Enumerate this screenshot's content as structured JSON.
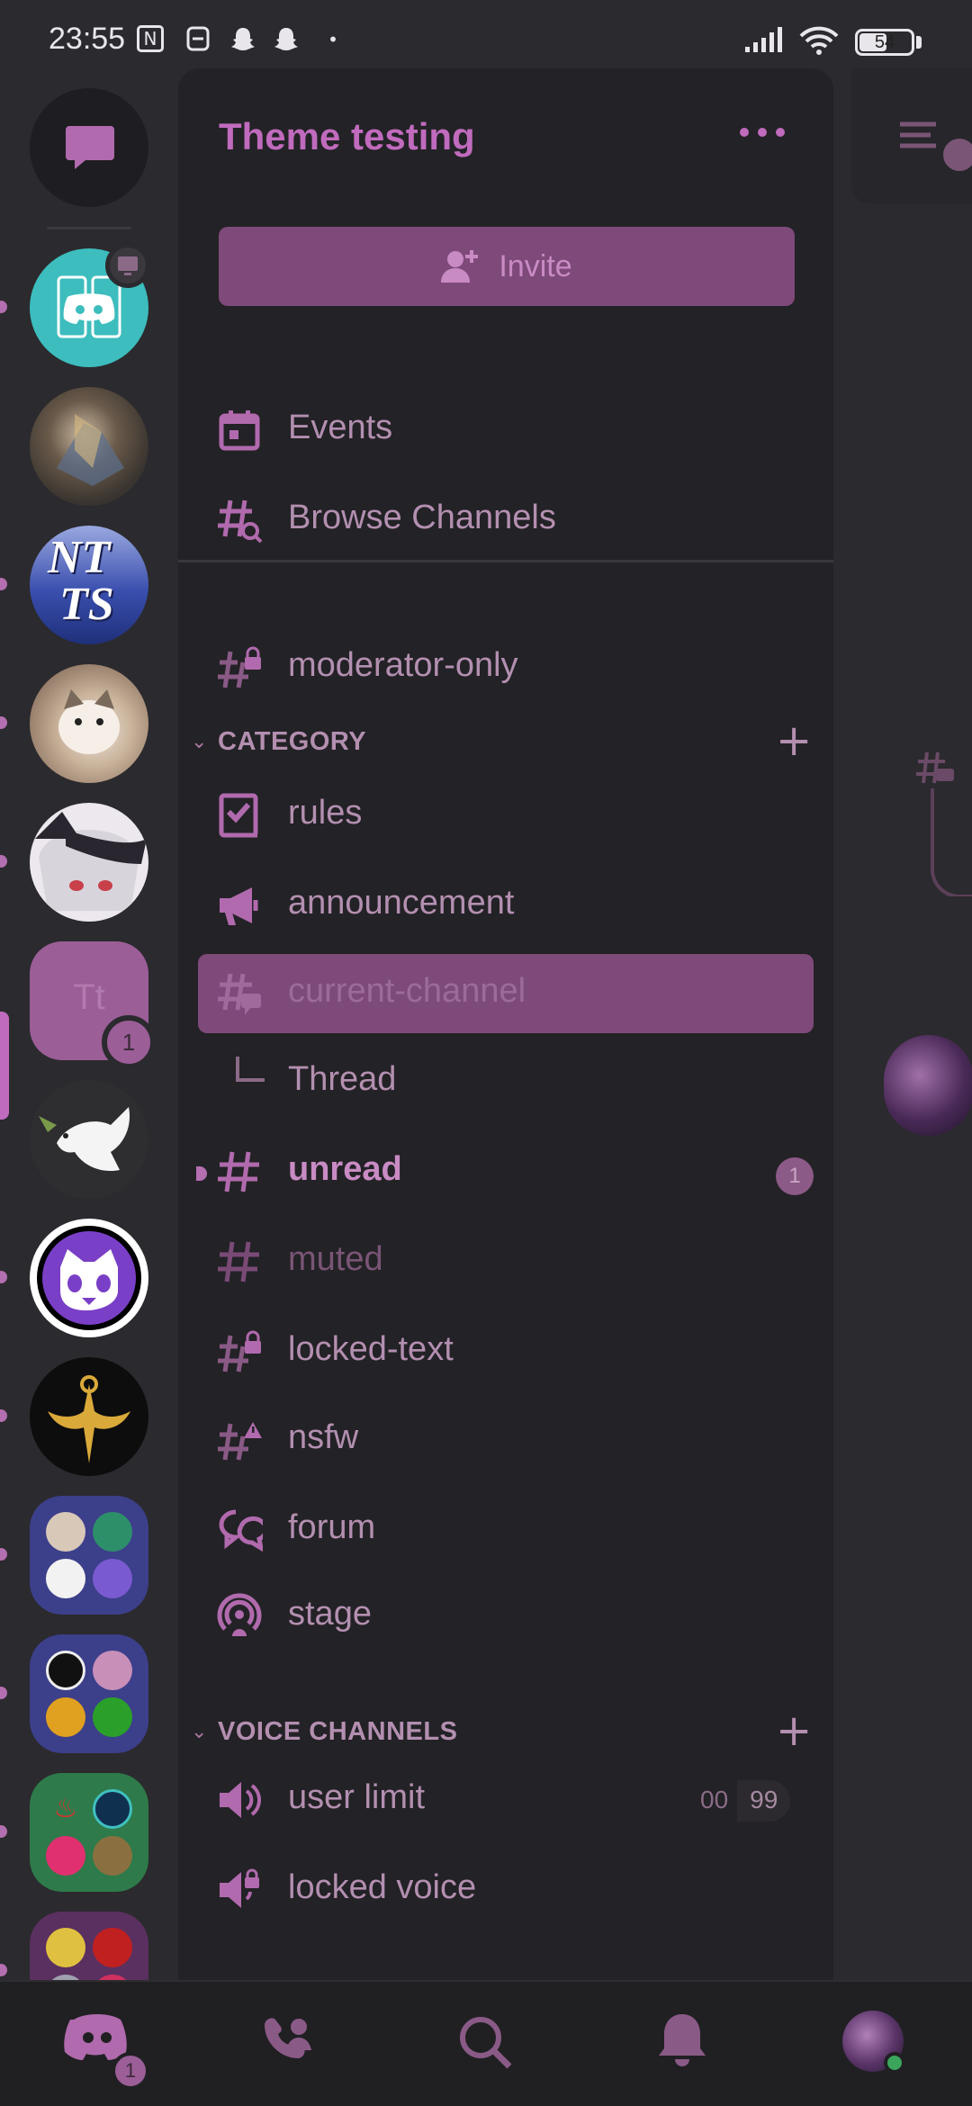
{
  "status_bar": {
    "time": "23:55",
    "battery": "54",
    "battery_level": 0.54,
    "icons": [
      "nfc-icon",
      "ticket-icon",
      "snapchat-icon",
      "snapchat-icon",
      "dot-icon",
      "signal-icon",
      "wifi-icon",
      "battery-icon"
    ]
  },
  "server_rail": {
    "dm_icon": "direct-messages-icon",
    "servers": [
      {
        "name": "discord-server",
        "color": "#3dbdbd",
        "pill": true
      },
      {
        "name": "warrior-server",
        "color": "#5a5045",
        "pill": false
      },
      {
        "name": "ntts-server",
        "text": "NT TS",
        "color": "#3a4fae",
        "pill": true
      },
      {
        "name": "cat-server",
        "color": "#a88d78",
        "pill": true
      },
      {
        "name": "anime-girl-server",
        "color": "#e8e4ea",
        "pill": true
      },
      {
        "name": "theme-testing-server",
        "text": "Tt",
        "color": "#9b5e97",
        "selected": true,
        "badge": "1"
      },
      {
        "name": "dove-server",
        "color": "#2e2d30",
        "pill": false
      },
      {
        "name": "redpanda-server",
        "color": "#7a3fc7",
        "pill": true
      },
      {
        "name": "gold-emblem-server",
        "color": "#0d0d0d",
        "pill": true
      },
      {
        "name": "folder-1",
        "color": "#3c3f8a",
        "pill": true
      },
      {
        "name": "folder-2",
        "color": "#3c3f8a",
        "pill": true
      },
      {
        "name": "folder-3",
        "color": "#2e7a4a",
        "pill": true
      },
      {
        "name": "folder-4",
        "color": "#5a3060",
        "pill": true
      }
    ]
  },
  "panel": {
    "server_title": "Theme testing",
    "invite_label": "Invite",
    "events_label": "Events",
    "browse_label": "Browse Channels",
    "top_channel": {
      "label": "moderator-only",
      "icon": "hash-lock-icon"
    },
    "categories": [
      {
        "label": "CATEGORY",
        "channels": [
          {
            "label": "rules",
            "icon": "rules-icon"
          },
          {
            "label": "announcement",
            "icon": "megaphone-icon"
          },
          {
            "label": "current-channel",
            "icon": "hash-thread-icon",
            "state": "active"
          },
          {
            "label": "Thread",
            "icon": "thread-branch-icon",
            "state": "thread"
          },
          {
            "label": "unread",
            "icon": "hash-icon",
            "state": "unread",
            "badge": "1"
          },
          {
            "label": "muted",
            "icon": "hash-icon",
            "state": "muted"
          },
          {
            "label": "locked-text",
            "icon": "hash-lock-icon"
          },
          {
            "label": "nsfw",
            "icon": "hash-warning-icon"
          },
          {
            "label": "forum",
            "icon": "forum-icon"
          },
          {
            "label": "stage",
            "icon": "stage-icon"
          }
        ]
      },
      {
        "label": "VOICE CHANNELS",
        "channels": [
          {
            "label": "user limit",
            "icon": "speaker-icon",
            "limit_current": "00",
            "limit_max": "99"
          },
          {
            "label": "locked voice",
            "icon": "speaker-lock-icon"
          }
        ]
      }
    ]
  },
  "bottom_nav": {
    "items": [
      "home-icon",
      "friends-icon",
      "search-icon",
      "notifications-icon",
      "profile-avatar"
    ],
    "home_badge": "1"
  },
  "colors": {
    "accent": "#c06bbd",
    "active_bg": "#7e4a7a",
    "panel_bg": "#232226",
    "page_bg": "#2b2a2e",
    "online": "#3ba55c"
  }
}
